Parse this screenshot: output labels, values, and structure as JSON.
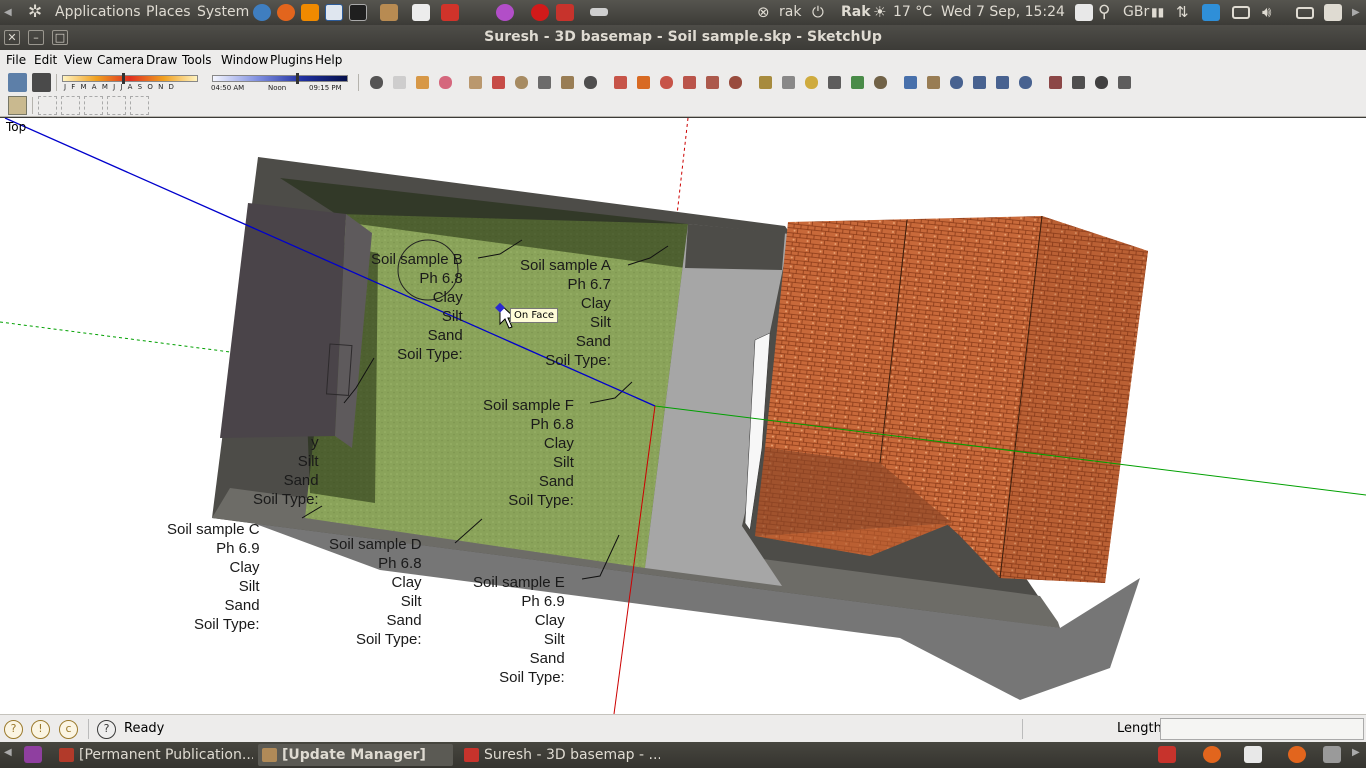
{
  "top_panel": {
    "menus": [
      "Applications",
      "Places",
      "System"
    ],
    "user": "rak",
    "location": "Rak",
    "temperature": "17 °C",
    "datetime": "Wed  7 Sep, 15:24",
    "keyboard_layout": "GBr",
    "launchers": [
      "firefox-icon",
      "vlc-icon",
      "remote-desktop-icon",
      "terminal-icon",
      "package-icon",
      "text-editor-icon",
      "screenshot-icon",
      "disk-icon",
      "opera-icon",
      "sketchup-icon",
      "scanner-icon"
    ],
    "tray": [
      "power-icon",
      "weather-sun-icon",
      "notes-icon",
      "search-icon",
      "signal-icon",
      "network-icon",
      "dropbox-icon",
      "monitor-icon",
      "volume-icon",
      "mail-icon",
      "lock-icon"
    ]
  },
  "window": {
    "title": "Suresh - 3D basemap - Soil sample.skp - SketchUp",
    "controls": [
      "close-icon",
      "minimize-icon",
      "maximize-icon"
    ]
  },
  "menubar": [
    "File",
    "Edit",
    "View",
    "Camera",
    "Draw",
    "Tools",
    "Window",
    "Plugins",
    "Help"
  ],
  "shadow_toolbar": {
    "months": "J F M A M J J A S O N D",
    "time_start": "04:50 AM",
    "time_mid": "Noon",
    "time_end": "09:15 PM"
  },
  "toolbar_tools": [
    "select-tool",
    "eraser-tool",
    "paint-bucket-tool",
    "eraser-tool",
    "rectangle-tool",
    "line-tool",
    "circle-tool",
    "arc-tool",
    "polygon-tool",
    "freehand-tool",
    "move-tool",
    "push-pull-tool",
    "rotate-tool",
    "follow-me-tool",
    "scale-tool",
    "offset-tool",
    "tape-measure-tool",
    "dimension-tool",
    "protractor-tool",
    "text-tool",
    "axes-tool",
    "3d-text-tool",
    "orbit-tool",
    "pan-tool",
    "zoom-tool",
    "zoom-window-tool",
    "zoom-extents-tool",
    "previous-view-tool",
    "position-camera-tool",
    "look-around-tool",
    "walk-tool",
    "section-plane-tool"
  ],
  "viewport": {
    "view_name": "Top",
    "tooltip": "On Face",
    "samples": [
      {
        "id": "A",
        "lines": [
          "Soil sample A",
          "Ph 6.7",
          "Clay",
          "Silt",
          "Sand",
          "Soil Type:"
        ]
      },
      {
        "id": "B",
        "lines": [
          "Soil sample B",
          "Ph 6.8",
          "Clay",
          "Silt",
          "Sand",
          "Soil Type:"
        ]
      },
      {
        "id": "F",
        "lines": [
          "Soil sample F",
          "Ph 6.8",
          "Clay",
          "Silt",
          "Sand",
          "Soil Type:"
        ]
      },
      {
        "id": "C",
        "lines": [
          "Soil sample C",
          "Ph 6.9",
          "Clay",
          "Silt",
          "Sand",
          "Soil Type:"
        ]
      },
      {
        "id": "D",
        "lines": [
          "Soil sample D",
          "Ph 6.8",
          "Clay",
          "Silt",
          "Sand",
          "Soil Type:"
        ]
      },
      {
        "id": "E",
        "lines": [
          "Soil sample E",
          "Ph 6.9",
          "Clay",
          "Silt",
          "Sand",
          "Soil Type:"
        ]
      },
      {
        "id": "hidden",
        "lines": [
          "y",
          "Silt",
          "Sand",
          "Soil Type:"
        ]
      }
    ]
  },
  "statusbar": {
    "status": "Ready",
    "measurement_label": "Length",
    "measurement_value": ""
  },
  "taskbar": [
    {
      "label": "[Permanent Publication...",
      "icon": "pdf-icon",
      "active": false
    },
    {
      "label": "[Update Manager]",
      "icon": "update-icon",
      "active": true
    },
    {
      "label": "Suresh - 3D basemap - ...",
      "icon": "sketchup-icon",
      "active": false
    }
  ],
  "colors": {
    "panel": "#3c3b37",
    "lawn": "#8aa35a",
    "roof": "#c8693a",
    "path": "#a6a6a6",
    "axis_red": "#cc0000",
    "axis_green": "#00a000",
    "axis_blue": "#0000cc"
  }
}
